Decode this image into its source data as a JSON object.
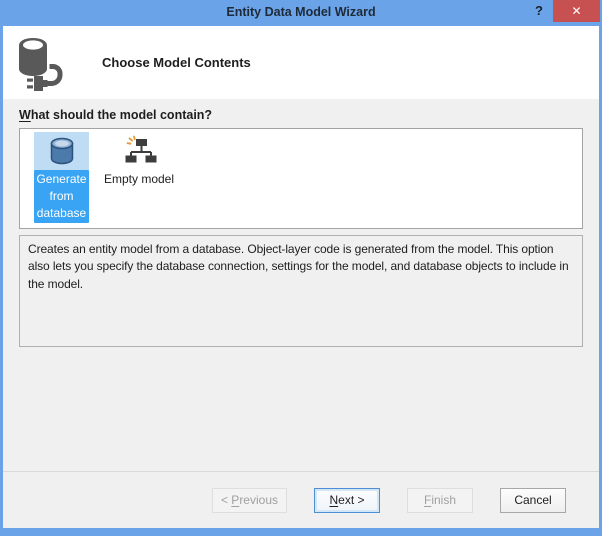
{
  "window": {
    "title": "Entity Data Model Wizard",
    "help_glyph": "?",
    "close_glyph": "✕"
  },
  "header": {
    "title": "Choose Model Contents",
    "icon": "database-plug-icon"
  },
  "body": {
    "question": {
      "pre": "",
      "key": "W",
      "post": "hat should the model contain?"
    },
    "options": [
      {
        "label": "Generate from database",
        "icon": "generate-from-database-icon",
        "selected": true
      },
      {
        "label": "Empty model",
        "icon": "empty-model-icon",
        "selected": false
      }
    ],
    "description": "Creates an entity model from a database. Object-layer code is generated from the model. This option also lets you specify the database connection, settings for the model, and database objects to include in the model."
  },
  "footer": {
    "buttons": [
      {
        "pre": "< ",
        "key": "P",
        "post": "revious",
        "enabled": false,
        "default": false
      },
      {
        "pre": "",
        "key": "N",
        "post": "ext >",
        "enabled": true,
        "default": true
      },
      {
        "pre": "",
        "key": "F",
        "post": "inish",
        "enabled": false,
        "default": false
      },
      {
        "pre": "Cancel",
        "key": "",
        "post": "",
        "enabled": true,
        "default": false
      }
    ]
  },
  "colors": {
    "titlebar_blue": "#6ba3e9",
    "close_red": "#c75050",
    "selection_blue": "#39a3f4",
    "selection_halo": "#bfdcf5",
    "dialog_bg": "#f0f0f0",
    "header_bg": "#ffffff"
  }
}
